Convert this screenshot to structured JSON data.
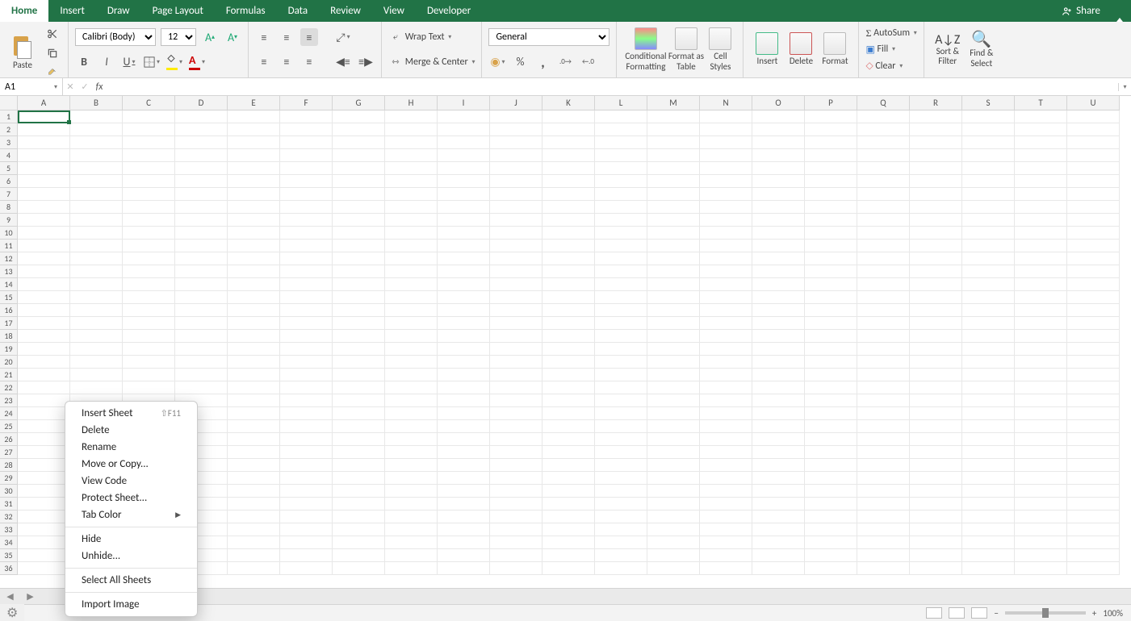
{
  "tabs": [
    "Home",
    "Insert",
    "Draw",
    "Page Layout",
    "Formulas",
    "Data",
    "Review",
    "View",
    "Developer"
  ],
  "active_tab": "Home",
  "share_label": "Share",
  "clipboard": {
    "paste": "Paste"
  },
  "font": {
    "name": "Calibri (Body)",
    "size": "12"
  },
  "alignment": {
    "wrap": "Wrap Text",
    "merge": "Merge & Center"
  },
  "number": {
    "format": "General"
  },
  "styles": {
    "cond": "Conditional Formatting",
    "table": "Format as Table",
    "cell": "Cell Styles"
  },
  "cells_grp": {
    "insert": "Insert",
    "delete": "Delete",
    "format": "Format"
  },
  "editing": {
    "autosum": "AutoSum",
    "fill": "Fill",
    "clear": "Clear",
    "sort": "Sort & Filter",
    "find": "Find & Select"
  },
  "namebox": "A1",
  "columns": [
    "A",
    "B",
    "C",
    "D",
    "E",
    "F",
    "G",
    "H",
    "I",
    "J",
    "K",
    "L",
    "M",
    "N",
    "O",
    "P",
    "Q",
    "R",
    "S",
    "T",
    "U"
  ],
  "row_count": 36,
  "context_menu": {
    "groups": [
      [
        {
          "label": "Insert Sheet",
          "shortcut": "⇧F11"
        },
        {
          "label": "Delete"
        },
        {
          "label": "Rename"
        },
        {
          "label": "Move or Copy..."
        },
        {
          "label": "View Code"
        },
        {
          "label": "Protect Sheet..."
        },
        {
          "label": "Tab Color",
          "submenu": true
        }
      ],
      [
        {
          "label": "Hide"
        },
        {
          "label": "Unhide..."
        }
      ],
      [
        {
          "label": "Select All Sheets"
        }
      ],
      [
        {
          "label": "Import Image"
        }
      ]
    ]
  },
  "zoom": "100%"
}
